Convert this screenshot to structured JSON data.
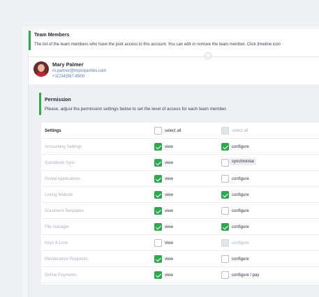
{
  "team_members": {
    "title": "Team Members",
    "description": "The list of the team members who have the joint access to this account. You can edit or remove the team member. Click timeline icon"
  },
  "member": {
    "name": "Mary Palmer",
    "email": "m.palmer@lmproperties.com",
    "phone": "+1(234)567-8900"
  },
  "permission": {
    "title": "Permission",
    "description": "Please, adjust the permission settings below to set the level of access for each team member."
  },
  "table": {
    "header": {
      "label": "Settings",
      "col1_label": "select all",
      "col2_label": "select all",
      "col1_checked": false,
      "col2_disabled": true
    },
    "rows": [
      {
        "label": "Accounting Settings",
        "view": true,
        "view_label": "view",
        "col2_label": "configure",
        "col2_checked": true
      },
      {
        "label": "Quickbook Sync",
        "view": true,
        "view_label": "view",
        "col2_label": "synchronise",
        "col2_checked": false
      },
      {
        "label": "Rental Applications",
        "view": true,
        "view_label": "view",
        "col2_label": "configure",
        "col2_checked": false
      },
      {
        "label": "Listing Website",
        "view": true,
        "view_label": "view",
        "col2_label": "configure",
        "col2_checked": true
      },
      {
        "label": "Document Templates",
        "view": true,
        "view_label": "view",
        "col2_label": "configure",
        "col2_checked": false
      },
      {
        "label": "File manager",
        "view": true,
        "view_label": "view",
        "col2_label": "configure",
        "col2_checked": true
      },
      {
        "label": "Keys & Lock",
        "view": false,
        "view_label": "view",
        "col2_label": "configure",
        "col2_checked": false,
        "col2_disabled": true
      },
      {
        "label": "Maintenance Requests",
        "view": true,
        "view_label": "view",
        "col2_label": "configure",
        "col2_checked": false
      },
      {
        "label": "Online Payments",
        "view": true,
        "view_label": "view",
        "col2_label": "configure / pay",
        "col2_checked": false
      }
    ]
  },
  "colors": {
    "accent": "#2ea84a",
    "link": "#5a7cb3"
  },
  "icons": {
    "expand": "chevron-down-icon"
  }
}
